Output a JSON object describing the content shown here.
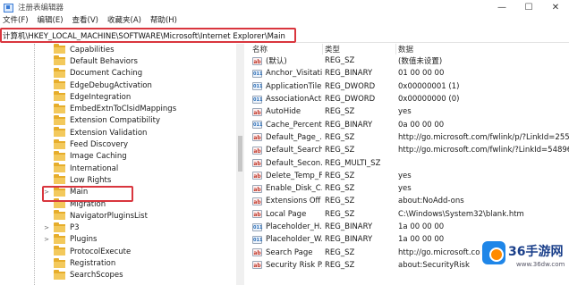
{
  "window": {
    "title": "注册表编辑器",
    "controls": {
      "minimize": "—",
      "maximize": "☐",
      "close": "✕"
    }
  },
  "menu": [
    "文件(F)",
    "编辑(E)",
    "查看(V)",
    "收藏夹(A)",
    "帮助(H)"
  ],
  "address": "计算机\\HKEY_LOCAL_MACHINE\\SOFTWARE\\Microsoft\\Internet Explorer\\Main",
  "tree": {
    "items": [
      {
        "label": "Capabilities",
        "expander": ""
      },
      {
        "label": "Default Behaviors",
        "expander": ""
      },
      {
        "label": "Document Caching",
        "expander": ""
      },
      {
        "label": "EdgeDebugActivation",
        "expander": ""
      },
      {
        "label": "EdgeIntegration",
        "expander": ""
      },
      {
        "label": "EmbedExtnToClsidMappings",
        "expander": ""
      },
      {
        "label": "Extension Compatibility",
        "expander": ""
      },
      {
        "label": "Extension Validation",
        "expander": ""
      },
      {
        "label": "Feed Discovery",
        "expander": ""
      },
      {
        "label": "Image Caching",
        "expander": ""
      },
      {
        "label": "International",
        "expander": ""
      },
      {
        "label": "Low Rights",
        "expander": ""
      },
      {
        "label": "Main",
        "expander": ">"
      },
      {
        "label": "Migration",
        "expander": ""
      },
      {
        "label": "NavigatorPluginsList",
        "expander": ""
      },
      {
        "label": "P3",
        "expander": ">"
      },
      {
        "label": "Plugins",
        "expander": ">"
      },
      {
        "label": "ProtocolExecute",
        "expander": ""
      },
      {
        "label": "Registration",
        "expander": ""
      },
      {
        "label": "SearchScopes",
        "expander": ""
      }
    ],
    "selected_index": 12
  },
  "list": {
    "columns": {
      "name": "名称",
      "type": "类型",
      "data": "数据"
    },
    "rows": [
      {
        "icon": "ab",
        "name": "(默认)",
        "type": "REG_SZ",
        "data": "(数值未设置)"
      },
      {
        "icon": "bin",
        "name": "Anchor_Visitati...",
        "type": "REG_BINARY",
        "data": "01 00 00 00"
      },
      {
        "icon": "bin",
        "name": "ApplicationTile...",
        "type": "REG_DWORD",
        "data": "0x00000001 (1)"
      },
      {
        "icon": "bin",
        "name": "AssociationActi...",
        "type": "REG_DWORD",
        "data": "0x00000000 (0)"
      },
      {
        "icon": "ab",
        "name": "AutoHide",
        "type": "REG_SZ",
        "data": "yes"
      },
      {
        "icon": "bin",
        "name": "Cache_Percent...",
        "type": "REG_BINARY",
        "data": "0a 00 00 00"
      },
      {
        "icon": "ab",
        "name": "Default_Page_...",
        "type": "REG_SZ",
        "data": "http://go.microsoft.com/fwlink/p/?LinkId=255"
      },
      {
        "icon": "ab",
        "name": "Default_Search...",
        "type": "REG_SZ",
        "data": "http://go.microsoft.com/fwlink/?LinkId=54896"
      },
      {
        "icon": "ab",
        "name": "Default_Secon...",
        "type": "REG_MULTI_SZ",
        "data": ""
      },
      {
        "icon": "ab",
        "name": "Delete_Temp_F...",
        "type": "REG_SZ",
        "data": "yes"
      },
      {
        "icon": "ab",
        "name": "Enable_Disk_C...",
        "type": "REG_SZ",
        "data": "yes"
      },
      {
        "icon": "ab",
        "name": "Extensions Off ...",
        "type": "REG_SZ",
        "data": "about:NoAdd-ons"
      },
      {
        "icon": "ab",
        "name": "Local Page",
        "type": "REG_SZ",
        "data": "C:\\Windows\\System32\\blank.htm"
      },
      {
        "icon": "bin",
        "name": "Placeholder_H...",
        "type": "REG_BINARY",
        "data": "1a 00 00 00"
      },
      {
        "icon": "bin",
        "name": "Placeholder_W...",
        "type": "REG_BINARY",
        "data": "1a 00 00 00"
      },
      {
        "icon": "ab",
        "name": "Search Page",
        "type": "REG_SZ",
        "data": "http://go.microsoft.com"
      },
      {
        "icon": "ab",
        "name": "Security Risk P...",
        "type": "REG_SZ",
        "data": "about:SecurityRisk"
      }
    ]
  },
  "watermark": {
    "brand": "36手游网",
    "url": "www.36dw.com"
  },
  "colors": {
    "highlight_border": "#d9363e",
    "folder": "#f3c95c",
    "brand_blue": "#1f86e8"
  }
}
